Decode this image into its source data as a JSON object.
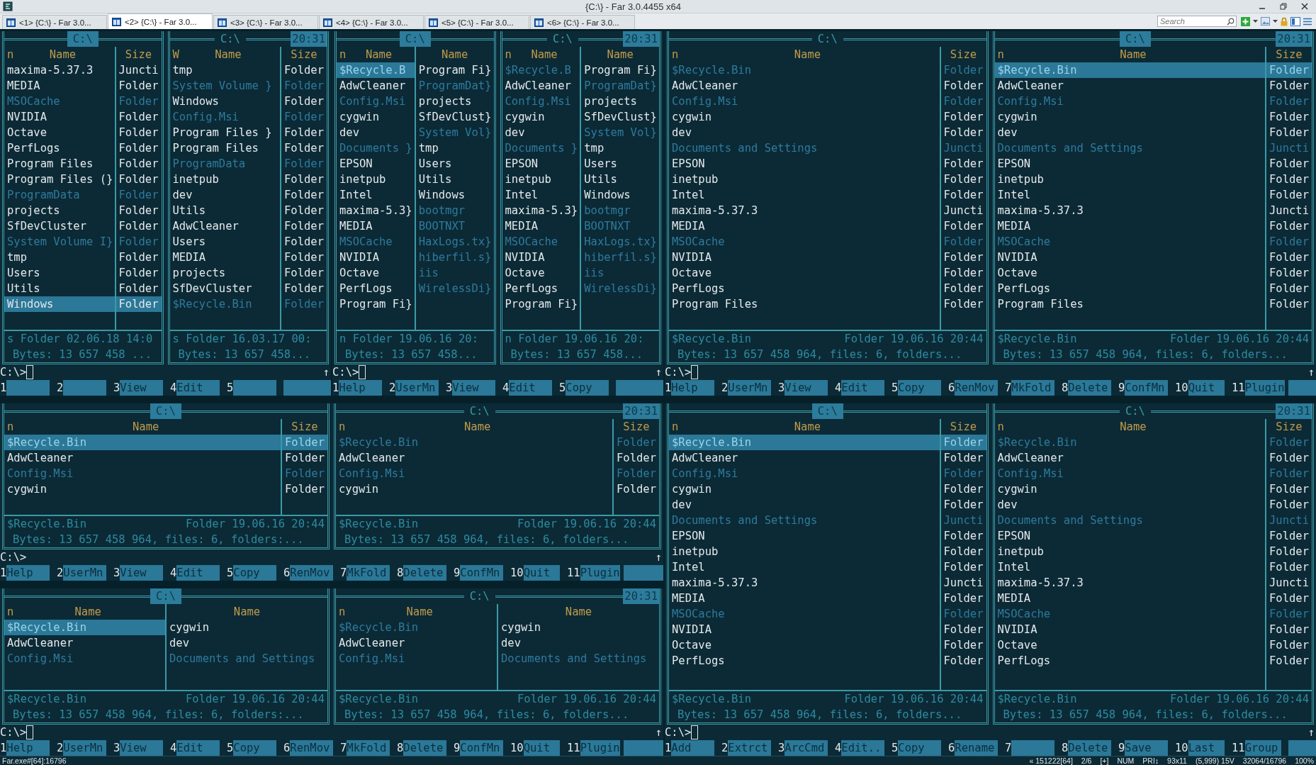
{
  "window": {
    "title": "{C:\\} - Far 3.0.4455 x64"
  },
  "tabs": [
    {
      "label": "<1> {C:\\} - Far 3.0...",
      "selected": false
    },
    {
      "label": "<2> {C:\\} - Far 3.0...",
      "selected": true
    },
    {
      "label": "<3> {C:\\} - Far 3.0...",
      "selected": false
    },
    {
      "label": "<4> {C:\\} - Far 3.0...",
      "selected": false
    },
    {
      "label": "<5> {C:\\} - Far 3.0...",
      "selected": false
    },
    {
      "label": "<6> {C:\\} - Far 3.0...",
      "selected": false
    }
  ],
  "search": {
    "placeholder": "Search"
  },
  "consoles": [
    {
      "panels": [
        {
          "path": "C:\\",
          "active": true,
          "sort_mark": "n",
          "kind": "full",
          "headings": [
            "Name",
            "Size"
          ],
          "rows": [
            {
              "name": "maxima-5.37.3",
              "size": "Juncti",
              "dim": false,
              "selected": false
            },
            {
              "name": "MEDIA",
              "size": "Folder",
              "dim": false,
              "selected": false
            },
            {
              "name": "MSOCache",
              "size": "Folder",
              "dim": true,
              "selected": false
            },
            {
              "name": "NVIDIA",
              "size": "Folder",
              "dim": false,
              "selected": false
            },
            {
              "name": "Octave",
              "size": "Folder",
              "dim": false,
              "selected": false
            },
            {
              "name": "PerfLogs",
              "size": "Folder",
              "dim": false,
              "selected": false
            },
            {
              "name": "Program Files",
              "size": "Folder",
              "dim": false,
              "selected": false
            },
            {
              "name": "Program Files (}",
              "size": "Folder",
              "dim": false,
              "selected": false
            },
            {
              "name": "ProgramData",
              "size": "Folder",
              "dim": true,
              "selected": false
            },
            {
              "name": "projects",
              "size": "Folder",
              "dim": false,
              "selected": false
            },
            {
              "name": "SfDevCluster",
              "size": "Folder",
              "dim": false,
              "selected": false
            },
            {
              "name": "System Volume I}",
              "size": "Folder",
              "dim": true,
              "selected": false
            },
            {
              "name": "tmp",
              "size": "Folder",
              "dim": false,
              "selected": false
            },
            {
              "name": "Users",
              "size": "Folder",
              "dim": false,
              "selected": false
            },
            {
              "name": "Utils",
              "size": "Folder",
              "dim": false,
              "selected": false
            },
            {
              "name": "Windows",
              "size": "Folder",
              "dim": false,
              "selected": true
            }
          ],
          "info": [
            "s Folder 02.06.18 14:0"
          ],
          "totals": "Bytes: 13 657 458 ..."
        },
        {
          "path": "C:\\",
          "active": false,
          "clock": "20:31",
          "sort_mark": "W",
          "kind": "full",
          "headings": [
            "Name",
            "Size"
          ],
          "rows": [
            {
              "name": "tmp",
              "size": "Folder",
              "dim": false,
              "selected": false
            },
            {
              "name": "System Volume }",
              "size": "Folder",
              "dim": true,
              "selected": false
            },
            {
              "name": "Windows",
              "size": "Folder",
              "dim": false,
              "selected": false
            },
            {
              "name": "Config.Msi",
              "size": "Folder",
              "dim": true,
              "selected": false
            },
            {
              "name": "Program Files }",
              "size": "Folder",
              "dim": false,
              "selected": false
            },
            {
              "name": "Program Files",
              "size": "Folder",
              "dim": false,
              "selected": false
            },
            {
              "name": "ProgramData",
              "size": "Folder",
              "dim": true,
              "selected": false
            },
            {
              "name": "inetpub",
              "size": "Folder",
              "dim": false,
              "selected": false
            },
            {
              "name": "dev",
              "size": "Folder",
              "dim": false,
              "selected": false
            },
            {
              "name": "Utils",
              "size": "Folder",
              "dim": false,
              "selected": false
            },
            {
              "name": "AdwCleaner",
              "size": "Folder",
              "dim": false,
              "selected": false
            },
            {
              "name": "Users",
              "size": "Folder",
              "dim": false,
              "selected": false
            },
            {
              "name": "MEDIA",
              "size": "Folder",
              "dim": false,
              "selected": false
            },
            {
              "name": "projects",
              "size": "Folder",
              "dim": false,
              "selected": false
            },
            {
              "name": "SfDevCluster",
              "size": "Folder",
              "dim": false,
              "selected": false
            },
            {
              "name": "$Recycle.Bin",
              "size": "Folder",
              "dim": true,
              "selected": false
            }
          ],
          "info": [
            "s Folder 16.03.17 00:"
          ],
          "totals": "Bytes: 13 657 458..."
        }
      ],
      "command": {
        "prompt": "C:\\>",
        "cursor": true,
        "scroll_mark": "↑"
      },
      "keys": [
        {
          "num": "1"
        },
        {
          "num": "2"
        },
        {
          "num": "3",
          "label": "View"
        },
        {
          "num": "4",
          "label": "Edit"
        },
        {
          "num": "5"
        }
      ]
    },
    {
      "panels": [
        {
          "path": "C:\\",
          "active": true,
          "sort_mark": "n",
          "kind": "brief",
          "columns": [
            {
              "heading": "Name",
              "cells": [
                {
                  "text": "$Recycle.B",
                  "dim": true,
                  "selected": true
                },
                {
                  "text": "AdwCleaner",
                  "dim": false,
                  "selected": false
                },
                {
                  "text": "Config.Msi",
                  "dim": true,
                  "selected": false
                },
                {
                  "text": "cygwin",
                  "dim": false,
                  "selected": false
                },
                {
                  "text": "dev",
                  "dim": false,
                  "selected": false
                },
                {
                  "text": "Documents }",
                  "dim": true,
                  "selected": false
                },
                {
                  "text": "EPSON",
                  "dim": false,
                  "selected": false
                },
                {
                  "text": "inetpub",
                  "dim": false,
                  "selected": false
                },
                {
                  "text": "Intel",
                  "dim": false,
                  "selected": false
                },
                {
                  "text": "maxima-5.3}",
                  "dim": false,
                  "selected": false
                },
                {
                  "text": "MEDIA",
                  "dim": false,
                  "selected": false
                },
                {
                  "text": "MSOCache",
                  "dim": true,
                  "selected": false
                },
                {
                  "text": "NVIDIA",
                  "dim": false,
                  "selected": false
                },
                {
                  "text": "Octave",
                  "dim": false,
                  "selected": false
                },
                {
                  "text": "PerfLogs",
                  "dim": false,
                  "selected": false
                },
                {
                  "text": "Program Fi}",
                  "dim": false,
                  "selected": false
                }
              ]
            },
            {
              "heading": "Name",
              "cells": [
                {
                  "text": "Program Fi}",
                  "dim": false,
                  "selected": false
                },
                {
                  "text": "ProgramDat}",
                  "dim": true,
                  "selected": false
                },
                {
                  "text": "projects",
                  "dim": false,
                  "selected": false
                },
                {
                  "text": "SfDevClust}",
                  "dim": false,
                  "selected": false
                },
                {
                  "text": "System Vol}",
                  "dim": true,
                  "selected": false
                },
                {
                  "text": "tmp",
                  "dim": false,
                  "selected": false
                },
                {
                  "text": "Users",
                  "dim": false,
                  "selected": false
                },
                {
                  "text": "Utils",
                  "dim": false,
                  "selected": false
                },
                {
                  "text": "Windows",
                  "dim": false,
                  "selected": false
                },
                {
                  "text": "bootmgr",
                  "dim": true,
                  "selected": false
                },
                {
                  "text": "BOOTNXT",
                  "dim": true,
                  "selected": false
                },
                {
                  "text": "HaxLogs.tx}",
                  "dim": true,
                  "selected": false
                },
                {
                  "text": "hiberfil.s}",
                  "dim": true,
                  "selected": false
                },
                {
                  "text": "iis",
                  "dim": true,
                  "selected": false
                },
                {
                  "text": "WirelessDi}",
                  "dim": true,
                  "selected": false
                }
              ]
            }
          ],
          "info": [
            "n Folder 19.06.16 20:"
          ],
          "totals": "Bytes: 13 657 458..."
        },
        {
          "path": "C:\\",
          "active": false,
          "clock": "20:31",
          "sort_mark": "n",
          "kind": "brief",
          "columns": [
            {
              "heading": "Name",
              "cells": [
                {
                  "text": "$Recycle.B",
                  "dim": true,
                  "selected": false
                },
                {
                  "text": "AdwCleaner",
                  "dim": false,
                  "selected": false
                },
                {
                  "text": "Config.Msi",
                  "dim": true,
                  "selected": false
                },
                {
                  "text": "cygwin",
                  "dim": false,
                  "selected": false
                },
                {
                  "text": "dev",
                  "dim": false,
                  "selected": false
                },
                {
                  "text": "Documents }",
                  "dim": true,
                  "selected": false
                },
                {
                  "text": "EPSON",
                  "dim": false,
                  "selected": false
                },
                {
                  "text": "inetpub",
                  "dim": false,
                  "selected": false
                },
                {
                  "text": "Intel",
                  "dim": false,
                  "selected": false
                },
                {
                  "text": "maxima-5.3}",
                  "dim": false,
                  "selected": false
                },
                {
                  "text": "MEDIA",
                  "dim": false,
                  "selected": false
                },
                {
                  "text": "MSOCache",
                  "dim": true,
                  "selected": false
                },
                {
                  "text": "NVIDIA",
                  "dim": false,
                  "selected": false
                },
                {
                  "text": "Octave",
                  "dim": false,
                  "selected": false
                },
                {
                  "text": "PerfLogs",
                  "dim": false,
                  "selected": false
                },
                {
                  "text": "Program Fi}",
                  "dim": false,
                  "selected": false
                }
              ]
            },
            {
              "heading": "Name",
              "cells": [
                {
                  "text": "Program Fi}",
                  "dim": false,
                  "selected": false
                },
                {
                  "text": "ProgramDat}",
                  "dim": true,
                  "selected": false
                },
                {
                  "text": "projects",
                  "dim": false,
                  "selected": false
                },
                {
                  "text": "SfDevClust}",
                  "dim": false,
                  "selected": false
                },
                {
                  "text": "System Vol}",
                  "dim": true,
                  "selected": false
                },
                {
                  "text": "tmp",
                  "dim": false,
                  "selected": false
                },
                {
                  "text": "Users",
                  "dim": false,
                  "selected": false
                },
                {
                  "text": "Utils",
                  "dim": false,
                  "selected": false
                },
                {
                  "text": "Windows",
                  "dim": false,
                  "selected": false
                },
                {
                  "text": "bootmgr",
                  "dim": true,
                  "selected": false
                },
                {
                  "text": "BOOTNXT",
                  "dim": true,
                  "selected": false
                },
                {
                  "text": "HaxLogs.tx}",
                  "dim": true,
                  "selected": false
                },
                {
                  "text": "hiberfil.s}",
                  "dim": true,
                  "selected": false
                },
                {
                  "text": "iis",
                  "dim": true,
                  "selected": false
                },
                {
                  "text": "WirelessDi}",
                  "dim": true,
                  "selected": false
                }
              ]
            }
          ],
          "info": [
            "n Folder 19.06.16 20:"
          ],
          "totals": "Bytes: 13 657 458..."
        }
      ],
      "command": {
        "prompt": "C:\\>",
        "cursor": true,
        "scroll_mark": "↑"
      },
      "keys": [
        {
          "num": "1",
          "label": "Help"
        },
        {
          "num": "2",
          "label": "UserMn"
        },
        {
          "num": "3",
          "label": "View"
        },
        {
          "num": "4",
          "label": "Edit"
        },
        {
          "num": "5",
          "label": "Copy"
        }
      ]
    },
    {
      "panels": [
        {
          "path": "C:\\",
          "active": false,
          "sort_mark": "n",
          "kind": "full",
          "headings": [
            "Name",
            "Size"
          ],
          "rows": [
            {
              "name": "$Recycle.Bin",
              "size": "Folder",
              "dim": true,
              "selected": false
            },
            {
              "name": "AdwCleaner",
              "size": "Folder",
              "dim": false,
              "selected": false
            },
            {
              "name": "Config.Msi",
              "size": "Folder",
              "dim": true,
              "selected": false
            },
            {
              "name": "cygwin",
              "size": "Folder",
              "dim": false,
              "selected": false
            },
            {
              "name": "dev",
              "size": "Folder",
              "dim": false,
              "selected": false
            },
            {
              "name": "Documents and Settings",
              "size": "Juncti",
              "dim": true,
              "selected": false
            },
            {
              "name": "EPSON",
              "size": "Folder",
              "dim": false,
              "selected": false
            },
            {
              "name": "inetpub",
              "size": "Folder",
              "dim": false,
              "selected": false
            },
            {
              "name": "Intel",
              "size": "Folder",
              "dim": false,
              "selected": false
            },
            {
              "name": "maxima-5.37.3",
              "size": "Juncti",
              "dim": false,
              "selected": false
            },
            {
              "name": "MEDIA",
              "size": "Folder",
              "dim": false,
              "selected": false
            },
            {
              "name": "MSOCache",
              "size": "Folder",
              "dim": true,
              "selected": false
            },
            {
              "name": "NVIDIA",
              "size": "Folder",
              "dim": false,
              "selected": false
            },
            {
              "name": "Octave",
              "size": "Folder",
              "dim": false,
              "selected": false
            },
            {
              "name": "PerfLogs",
              "size": "Folder",
              "dim": false,
              "selected": false
            },
            {
              "name": "Program Files",
              "size": "Folder",
              "dim": false,
              "selected": false
            }
          ],
          "info": [
            "$Recycle.Bin",
            "Folder 19.06.16 20:44"
          ],
          "totals": "Bytes: 13 657 458 964, files: 6, folders..."
        },
        {
          "path": "C:\\",
          "active": true,
          "clock": "20:31",
          "sort_mark": "n",
          "kind": "full",
          "headings": [
            "Name",
            "Size"
          ],
          "rows": [
            {
              "name": "$Recycle.Bin",
              "size": "Folder",
              "dim": true,
              "selected": true
            },
            {
              "name": "AdwCleaner",
              "size": "Folder",
              "dim": false,
              "selected": false
            },
            {
              "name": "Config.Msi",
              "size": "Folder",
              "dim": true,
              "selected": false
            },
            {
              "name": "cygwin",
              "size": "Folder",
              "dim": false,
              "selected": false
            },
            {
              "name": "dev",
              "size": "Folder",
              "dim": false,
              "selected": false
            },
            {
              "name": "Documents and Settings",
              "size": "Juncti",
              "dim": true,
              "selected": false
            },
            {
              "name": "EPSON",
              "size": "Folder",
              "dim": false,
              "selected": false
            },
            {
              "name": "inetpub",
              "size": "Folder",
              "dim": false,
              "selected": false
            },
            {
              "name": "Intel",
              "size": "Folder",
              "dim": false,
              "selected": false
            },
            {
              "name": "maxima-5.37.3",
              "size": "Juncti",
              "dim": false,
              "selected": false
            },
            {
              "name": "MEDIA",
              "size": "Folder",
              "dim": false,
              "selected": false
            },
            {
              "name": "MSOCache",
              "size": "Folder",
              "dim": true,
              "selected": false
            },
            {
              "name": "NVIDIA",
              "size": "Folder",
              "dim": false,
              "selected": false
            },
            {
              "name": "Octave",
              "size": "Folder",
              "dim": false,
              "selected": false
            },
            {
              "name": "PerfLogs",
              "size": "Folder",
              "dim": false,
              "selected": false
            },
            {
              "name": "Program Files",
              "size": "Folder",
              "dim": false,
              "selected": false
            }
          ],
          "info": [
            "$Recycle.Bin",
            "Folder 19.06.16 20:44"
          ],
          "totals": "Bytes: 13 657 458 964, files: 6, folders..."
        }
      ],
      "command": {
        "prompt": "C:\\>",
        "cursor": true,
        "scroll_mark": "↑"
      },
      "keys": [
        {
          "num": "1",
          "label": "Help"
        },
        {
          "num": "2",
          "label": "UserMn"
        },
        {
          "num": "3",
          "label": "View"
        },
        {
          "num": "4",
          "label": "Edit"
        },
        {
          "num": "5",
          "label": "Copy"
        },
        {
          "num": "6",
          "label": "RenMov"
        },
        {
          "num": "7",
          "label": "MkFold"
        },
        {
          "num": "8",
          "label": "Delete"
        },
        {
          "num": "9",
          "label": "ConfMn"
        },
        {
          "num": "10",
          "label": "Quit"
        },
        {
          "num": "11",
          "label": "Plugin"
        }
      ]
    },
    {
      "panels": [
        {
          "path": "C:\\",
          "active": true,
          "sort_mark": "n",
          "kind": "full",
          "headings": [
            "Name",
            "Size"
          ],
          "rows": [
            {
              "name": "$Recycle.Bin",
              "size": "Folder",
              "dim": true,
              "selected": true
            },
            {
              "name": "AdwCleaner",
              "size": "Folder",
              "dim": false,
              "selected": false
            },
            {
              "name": "Config.Msi",
              "size": "Folder",
              "dim": true,
              "selected": false
            },
            {
              "name": "cygwin",
              "size": "Folder",
              "dim": false,
              "selected": false
            }
          ],
          "info": [
            "$Recycle.Bin",
            "Folder 19.06.16 20:44"
          ],
          "totals": "Bytes: 13 657 458 964, files: 6, folders:..."
        },
        {
          "path": "C:\\",
          "active": false,
          "clock": "20:31",
          "sort_mark": "n",
          "kind": "full",
          "headings": [
            "Name",
            "Size"
          ],
          "rows": [
            {
              "name": "$Recycle.Bin",
              "size": "Folder",
              "dim": true,
              "selected": false
            },
            {
              "name": "AdwCleaner",
              "size": "Folder",
              "dim": false,
              "selected": false
            },
            {
              "name": "Config.Msi",
              "size": "Folder",
              "dim": true,
              "selected": false
            },
            {
              "name": "cygwin",
              "size": "Folder",
              "dim": false,
              "selected": false
            }
          ],
          "info": [
            "$Recycle.Bin",
            "Folder 19.06.16 20:44"
          ],
          "totals": "Bytes: 13 657 458 964, files: 6, folders..."
        }
      ],
      "command": {
        "prompt": "C:\\>",
        "cursor": false,
        "scroll_mark": "↑"
      },
      "keys": [
        {
          "num": "1",
          "label": "Help"
        },
        {
          "num": "2",
          "label": "UserMn"
        },
        {
          "num": "3",
          "label": "View"
        },
        {
          "num": "4",
          "label": "Edit"
        },
        {
          "num": "5",
          "label": "Copy"
        },
        {
          "num": "6",
          "label": "RenMov"
        },
        {
          "num": "7",
          "label": "MkFold"
        },
        {
          "num": "8",
          "label": "Delete"
        },
        {
          "num": "9",
          "label": "ConfMn"
        },
        {
          "num": "10",
          "label": "Quit"
        },
        {
          "num": "11",
          "label": "Plugin"
        }
      ]
    },
    {
      "panels": [
        {
          "path": "C:\\",
          "active": true,
          "sort_mark": "n",
          "kind": "brief",
          "columns": [
            {
              "heading": "Name",
              "cells": [
                {
                  "text": "$Recycle.Bin",
                  "dim": true,
                  "selected": true
                },
                {
                  "text": "AdwCleaner",
                  "dim": false,
                  "selected": false
                },
                {
                  "text": "Config.Msi",
                  "dim": true,
                  "selected": false
                }
              ]
            },
            {
              "heading": "Name",
              "cells": [
                {
                  "text": "cygwin",
                  "dim": false,
                  "selected": false
                },
                {
                  "text": "dev",
                  "dim": false,
                  "selected": false
                },
                {
                  "text": "Documents and Settings",
                  "dim": true,
                  "selected": false
                }
              ]
            }
          ],
          "info": [
            "$Recycle.Bin",
            "Folder 19.06.16 20:44"
          ],
          "totals": "Bytes: 13 657 458 964, files: 6, folders:..."
        },
        {
          "path": "C:\\",
          "active": false,
          "clock": "20:31",
          "sort_mark": "n",
          "kind": "brief",
          "columns": [
            {
              "heading": "Name",
              "cells": [
                {
                  "text": "$Recycle.Bin",
                  "dim": true,
                  "selected": false
                },
                {
                  "text": "AdwCleaner",
                  "dim": false,
                  "selected": false
                },
                {
                  "text": "Config.Msi",
                  "dim": true,
                  "selected": false
                }
              ]
            },
            {
              "heading": "Name",
              "cells": [
                {
                  "text": "cygwin",
                  "dim": false,
                  "selected": false
                },
                {
                  "text": "dev",
                  "dim": false,
                  "selected": false
                },
                {
                  "text": "Documents and Settings",
                  "dim": true,
                  "selected": false
                }
              ]
            }
          ],
          "info": [
            "$Recycle.Bin",
            "Folder 19.06.16 20:44"
          ],
          "totals": "Bytes: 13 657 458 964, files: 6, folders..."
        }
      ],
      "command": {
        "prompt": "C:\\>",
        "cursor": true,
        "scroll_mark": "↑"
      },
      "keys": [
        {
          "num": "1",
          "label": "Help"
        },
        {
          "num": "2",
          "label": "UserMn"
        },
        {
          "num": "3",
          "label": "View"
        },
        {
          "num": "4",
          "label": "Edit"
        },
        {
          "num": "5",
          "label": "Copy"
        },
        {
          "num": "6",
          "label": "RenMov"
        },
        {
          "num": "7",
          "label": "MkFold"
        },
        {
          "num": "8",
          "label": "Delete"
        },
        {
          "num": "9",
          "label": "ConfMn"
        },
        {
          "num": "10",
          "label": "Quit"
        },
        {
          "num": "11",
          "label": "Plugin"
        }
      ]
    },
    {
      "panels": [
        {
          "path": "C:\\",
          "active": true,
          "sort_mark": "n",
          "kind": "full",
          "headings": [
            "Name",
            "Size"
          ],
          "rows": [
            {
              "name": "$Recycle.Bin",
              "size": "Folder",
              "dim": true,
              "selected": true
            },
            {
              "name": "AdwCleaner",
              "size": "Folder",
              "dim": false,
              "selected": false
            },
            {
              "name": "Config.Msi",
              "size": "Folder",
              "dim": true,
              "selected": false
            },
            {
              "name": "cygwin",
              "size": "Folder",
              "dim": false,
              "selected": false
            },
            {
              "name": "dev",
              "size": "Folder",
              "dim": false,
              "selected": false
            },
            {
              "name": "Documents and Settings",
              "size": "Juncti",
              "dim": true,
              "selected": false
            },
            {
              "name": "EPSON",
              "size": "Folder",
              "dim": false,
              "selected": false
            },
            {
              "name": "inetpub",
              "size": "Folder",
              "dim": false,
              "selected": false
            },
            {
              "name": "Intel",
              "size": "Folder",
              "dim": false,
              "selected": false
            },
            {
              "name": "maxima-5.37.3",
              "size": "Juncti",
              "dim": false,
              "selected": false
            },
            {
              "name": "MEDIA",
              "size": "Folder",
              "dim": false,
              "selected": false
            },
            {
              "name": "MSOCache",
              "size": "Folder",
              "dim": true,
              "selected": false
            },
            {
              "name": "NVIDIA",
              "size": "Folder",
              "dim": false,
              "selected": false
            },
            {
              "name": "Octave",
              "size": "Folder",
              "dim": false,
              "selected": false
            },
            {
              "name": "PerfLogs",
              "size": "Folder",
              "dim": false,
              "selected": false
            }
          ],
          "info": [
            "$Recycle.Bin",
            "Folder 19.06.16 20:44"
          ],
          "totals": "Bytes: 13 657 458 964, files: 6, folders..."
        },
        {
          "path": "C:\\",
          "active": false,
          "clock": "20:31",
          "sort_mark": "n",
          "kind": "full",
          "headings": [
            "Name",
            "Size"
          ],
          "rows": [
            {
              "name": "$Recycle.Bin",
              "size": "Folder",
              "dim": true,
              "selected": false
            },
            {
              "name": "AdwCleaner",
              "size": "Folder",
              "dim": false,
              "selected": false
            },
            {
              "name": "Config.Msi",
              "size": "Folder",
              "dim": true,
              "selected": false
            },
            {
              "name": "cygwin",
              "size": "Folder",
              "dim": false,
              "selected": false
            },
            {
              "name": "dev",
              "size": "Folder",
              "dim": false,
              "selected": false
            },
            {
              "name": "Documents and Settings",
              "size": "Juncti",
              "dim": true,
              "selected": false
            },
            {
              "name": "EPSON",
              "size": "Folder",
              "dim": false,
              "selected": false
            },
            {
              "name": "inetpub",
              "size": "Folder",
              "dim": false,
              "selected": false
            },
            {
              "name": "Intel",
              "size": "Folder",
              "dim": false,
              "selected": false
            },
            {
              "name": "maxima-5.37.3",
              "size": "Juncti",
              "dim": false,
              "selected": false
            },
            {
              "name": "MEDIA",
              "size": "Folder",
              "dim": false,
              "selected": false
            },
            {
              "name": "MSOCache",
              "size": "Folder",
              "dim": true,
              "selected": false
            },
            {
              "name": "NVIDIA",
              "size": "Folder",
              "dim": false,
              "selected": false
            },
            {
              "name": "Octave",
              "size": "Folder",
              "dim": false,
              "selected": false
            },
            {
              "name": "PerfLogs",
              "size": "Folder",
              "dim": false,
              "selected": false
            }
          ],
          "info": [
            "$Recycle.Bin",
            "Folder 19.06.16 20:44"
          ],
          "totals": "Bytes: 13 657 458 964, files: 6, folders..."
        }
      ],
      "command": {
        "prompt": "C:\\>",
        "cursor": true,
        "scroll_mark": "↑"
      },
      "keys": [
        {
          "num": "1",
          "label": "Add"
        },
        {
          "num": "2",
          "label": "Extrct"
        },
        {
          "num": "3",
          "label": "ArcCmd"
        },
        {
          "num": "4",
          "label": "Edit.."
        },
        {
          "num": "5",
          "label": "Copy"
        },
        {
          "num": "6",
          "label": "Rename"
        },
        {
          "num": "7"
        },
        {
          "num": "8",
          "label": "Delete"
        },
        {
          "num": "9",
          "label": "Save"
        },
        {
          "num": "10",
          "label": "Last"
        },
        {
          "num": "11",
          "label": "Group"
        }
      ]
    }
  ],
  "status_bar": {
    "process": "Far.exe#[64]:16796",
    "segments": [
      "« 151222[64]",
      "2/6",
      "[+]",
      "NUM",
      "PRI↕",
      "93x11",
      "(5,999) 15V",
      "32064/16796",
      "100%"
    ]
  }
}
